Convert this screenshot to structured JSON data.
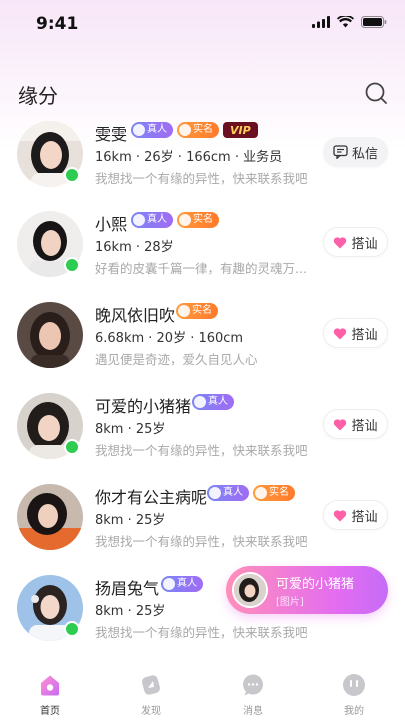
{
  "status_bar": {
    "time": "9:41"
  },
  "header": {
    "title": "缘分"
  },
  "users": [
    {
      "name": "雯雯",
      "badges": [
        "真人",
        "实名",
        "VIP"
      ],
      "meta": "16km · 26岁 · 166cm · 业务员",
      "bio": "我想找一个有缘的异性，快来联系我吧",
      "online": true,
      "action": "私信"
    },
    {
      "name": "小熙",
      "badges": [
        "真人",
        "实名"
      ],
      "meta": "16km · 28岁",
      "bio": "好看的皮囊千篇一律，有趣的灵魂万...",
      "online": true,
      "action": "搭讪"
    },
    {
      "name": "晚风依旧吹",
      "badges": [
        "实名"
      ],
      "meta": "6.68km · 20岁 · 160cm",
      "bio": "遇见便是奇迹，爱久自见人心",
      "online": false,
      "action": "搭讪"
    },
    {
      "name": "可爱的小猪猪",
      "badges": [
        "真人"
      ],
      "meta": "8km · 25岁",
      "bio": "我想找一个有缘的异性，快来联系我吧",
      "online": true,
      "action": "搭讪"
    },
    {
      "name": "你才有公主病呢",
      "badges": [
        "真人",
        "实名"
      ],
      "meta": "8km · 25岁",
      "bio": "我想找一个有缘的异性，快来联系我吧",
      "online": false,
      "action": "搭讪"
    },
    {
      "name": "扬眉兔气",
      "badges": [
        "真人"
      ],
      "meta": "8km · 25岁",
      "bio": "我想找一个有缘的异性，快来联系我吧",
      "online": true,
      "action": ""
    }
  ],
  "toast": {
    "name": "可爱的小猪猪",
    "sub": "[图片]"
  },
  "tabs": [
    {
      "label": "首页",
      "active": true
    },
    {
      "label": "发现",
      "active": false
    },
    {
      "label": "消息",
      "active": false
    },
    {
      "label": "我的",
      "active": false
    }
  ],
  "colors": {
    "accent": "#e26cf2",
    "online": "#2ecc50",
    "heart": "#ff5fa8",
    "real_badge": "#8a7bf5",
    "name_badge": "#ff8a34"
  }
}
